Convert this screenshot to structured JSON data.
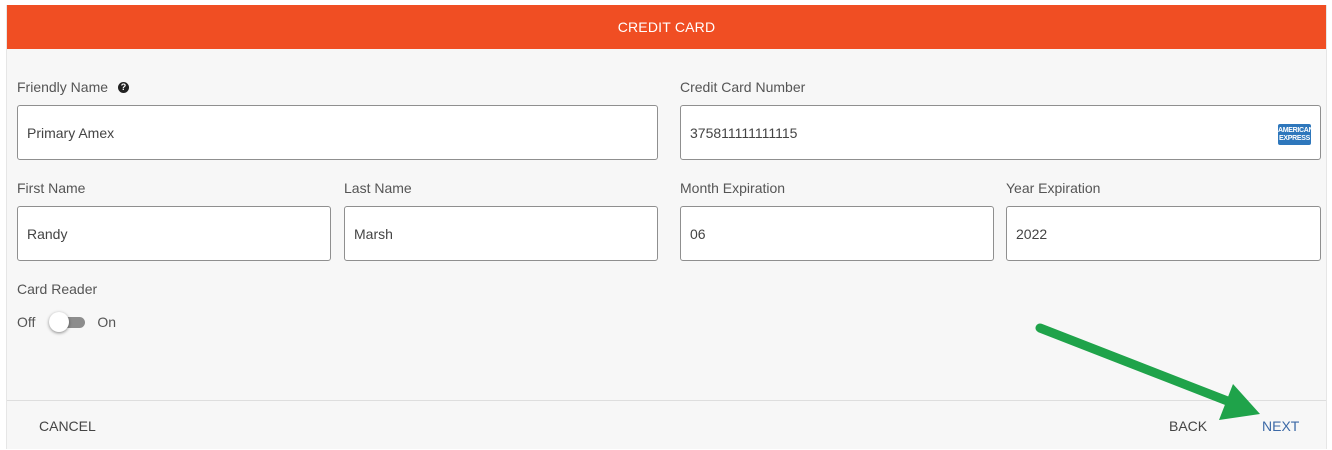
{
  "dialog": {
    "title": "CREDIT CARD"
  },
  "form": {
    "friendly_name": {
      "label": "Friendly Name",
      "value": "Primary Amex"
    },
    "card_number": {
      "label": "Credit Card Number",
      "value": "375811111111115",
      "card_brand_icon": "amex-icon"
    },
    "first_name": {
      "label": "First Name",
      "value": "Randy"
    },
    "last_name": {
      "label": "Last Name",
      "value": "Marsh"
    },
    "month_expiration": {
      "label": "Month Expiration",
      "value": "06"
    },
    "year_expiration": {
      "label": "Year Expiration",
      "value": "2022"
    },
    "card_reader": {
      "label": "Card Reader",
      "off_label": "Off",
      "on_label": "On",
      "state": "off"
    }
  },
  "amex_logo": {
    "line1": "AMERICAN",
    "line2": "EXPRESS"
  },
  "footer": {
    "cancel_label": "CANCEL",
    "back_label": "BACK",
    "next_label": "NEXT"
  },
  "colors": {
    "header": "#f04e23",
    "next": "#3d6aa7",
    "arrow": "#1fa34a"
  }
}
